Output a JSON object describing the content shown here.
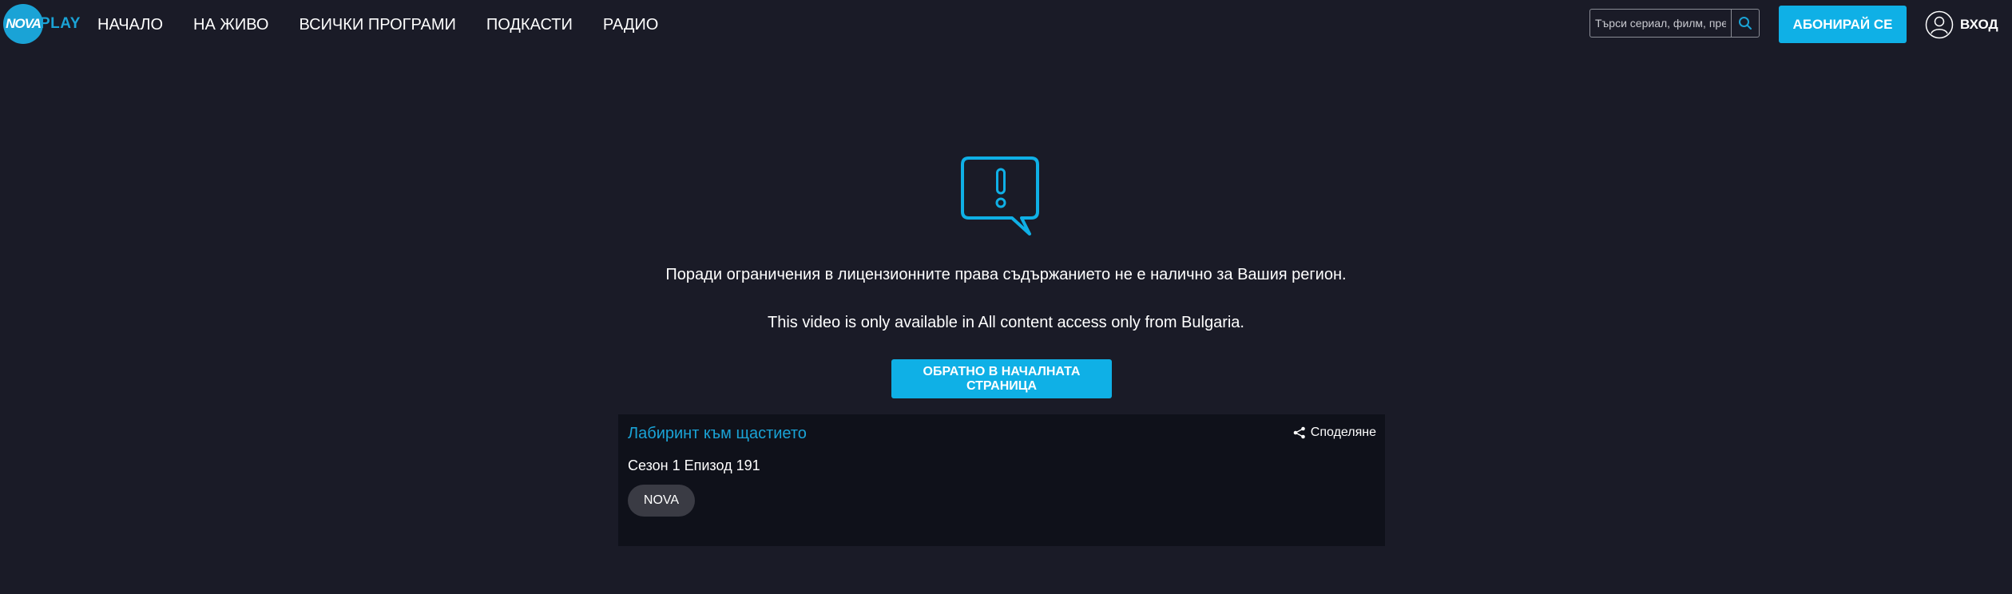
{
  "header": {
    "logo": {
      "nova": "NOVA",
      "play": "PLAY"
    },
    "nav": [
      {
        "label": "НАЧАЛО"
      },
      {
        "label": "НА ЖИВО"
      },
      {
        "label": "ВСИЧКИ ПРОГРАМИ"
      },
      {
        "label": "ПОДКАСТИ"
      },
      {
        "label": "РАДИО"
      }
    ],
    "search": {
      "placeholder": "Търси сериал, филм, пре",
      "value": "",
      "icon": "search-icon"
    },
    "subscribe_label": "АБОНИРАЙ СЕ",
    "login": {
      "label": "ВХОД",
      "icon": "user-icon"
    }
  },
  "error": {
    "icon": "warning-speech-bubble-icon",
    "message_bg": "Поради ограничения в лицензионните права съдържанието не е налично за Вашия регион.",
    "message_en": "This video is only available in All content access only from Bulgaria.",
    "back_button_label": "ОБРАТНО В НАЧАЛНАТА СТРАНИЦА"
  },
  "card": {
    "title": "Лабиринт към щастието",
    "share_label": "Споделяне",
    "share_icon": "share-icon",
    "episode": "Сезон 1 Епизод 191",
    "channel": "NOVA"
  },
  "colors": {
    "background": "#1a1b27",
    "accent": "#0fb0e6",
    "card_background": "#0f111a",
    "badge_background": "#3a3b44"
  }
}
